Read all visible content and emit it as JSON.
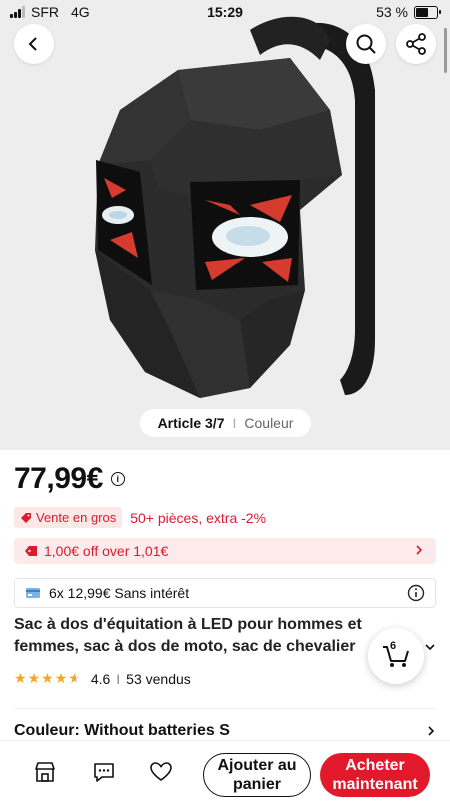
{
  "status_bar": {
    "carrier": "SFR",
    "network": "4G",
    "time": "15:29",
    "battery": "53 %",
    "battery_level": 0.53
  },
  "hero": {
    "pager_current": "Article 3/7",
    "pager_separator": "I",
    "pager_tab": "Couleur"
  },
  "price": {
    "value": "77,99€",
    "info_icon": "info-icon"
  },
  "promo": {
    "badge": "Vente en gros",
    "text": "50+ pièces, extra -2%"
  },
  "coupon": {
    "text": "1,00€ off over 1,01€"
  },
  "installment": {
    "text": "6x 12,99€ Sans intérêt"
  },
  "product": {
    "title_line1": "Sac à dos d'équitation à LED pour hommes et",
    "title_line2": "femmes, sac à dos de moto, sac de chevalier"
  },
  "rating": {
    "score": "4.6",
    "separator": "I",
    "sold": "53 vendus",
    "stars_value": 4.6
  },
  "cart": {
    "count": "6"
  },
  "variant": {
    "label": "Couleur: Without batteries S"
  },
  "bottom_bar": {
    "add_to_cart": "Ajouter au panier",
    "buy_now": "Acheter maintenant"
  },
  "colors": {
    "accent_red": "#e2182b",
    "promo_red": "#d91c2f",
    "star": "#f5a623"
  }
}
